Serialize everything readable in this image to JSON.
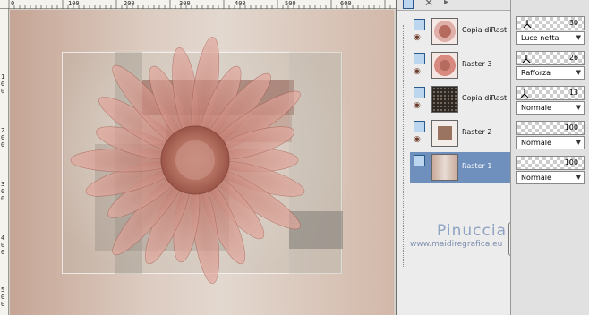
{
  "ruler": {
    "top_ticks": [
      "0",
      "100",
      "200",
      "300",
      "400",
      "500",
      "600"
    ],
    "left_ticks": [
      "1\n0\n0",
      "2\n0\n0",
      "3\n0\n0",
      "4\n0\n0",
      "5\n0\n0"
    ]
  },
  "layers": [
    {
      "name": "Copia diRast",
      "type": "raster-layer",
      "visible": true,
      "selected": false
    },
    {
      "name": "Raster 3",
      "type": "raster-layer",
      "visible": true,
      "selected": false
    },
    {
      "name": "Copia diRast",
      "type": "raster-layer",
      "visible": true,
      "selected": false
    },
    {
      "name": "Raster 2",
      "type": "raster-layer",
      "visible": true,
      "selected": false
    },
    {
      "name": "Raster 1",
      "type": "raster-layer",
      "visible": true,
      "selected": true
    }
  ],
  "properties": [
    {
      "opacity": "30",
      "blend": "Luce netta"
    },
    {
      "opacity": "26",
      "blend": "Rafforza"
    },
    {
      "opacity": "13",
      "blend": "Normale"
    },
    {
      "opacity": "100",
      "blend": "Normale"
    },
    {
      "opacity": "100",
      "blend": "Normale"
    }
  ],
  "watermark": {
    "name": "Pinuccia",
    "url": "www.maidiregrafica.eu"
  },
  "colors": {
    "selection": "#6f8fbd",
    "flower": "#c97a6c",
    "canvas_bg": "#dccbc0"
  }
}
